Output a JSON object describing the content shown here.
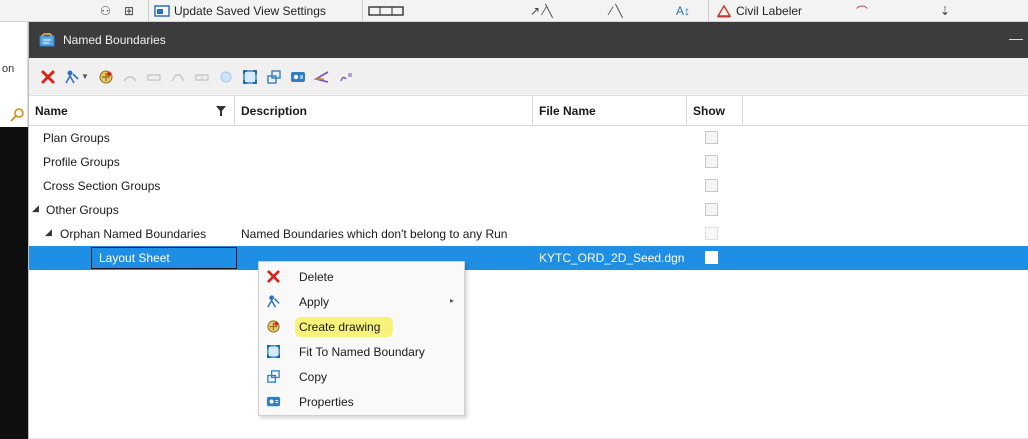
{
  "ribbon": {
    "update_saved_view_label": "Update Saved View Settings",
    "civil_labeler_label": "Civil Labeler",
    "left_fragment": "on"
  },
  "dialog": {
    "title": "Named Boundaries",
    "minimize_glyph": "—"
  },
  "toolbar": {
    "icons": [
      "delete-icon",
      "apply-icon",
      "create-drawing-icon",
      "plan-icon",
      "profile-icon",
      "cross-section-icon",
      "civil-icon",
      "named-boundary-icon",
      "fit-icon",
      "copy-icon",
      "properties-icon",
      "level-icon",
      "annotate-icon"
    ]
  },
  "grid": {
    "columns": [
      "Name",
      "Description",
      "File Name",
      "Show"
    ],
    "rows": [
      {
        "name": "Plan Groups",
        "description": "",
        "file": "",
        "level": 0,
        "expander": ""
      },
      {
        "name": "Profile Groups",
        "description": "",
        "file": "",
        "level": 0,
        "expander": ""
      },
      {
        "name": "Cross Section Groups",
        "description": "",
        "file": "",
        "level": 0,
        "expander": ""
      },
      {
        "name": "Other Groups",
        "description": "",
        "file": "",
        "level": 0,
        "expander": "◢"
      },
      {
        "name": "Orphan Named Boundaries",
        "description": "Named Boundaries which don't belong to any Run",
        "file": "",
        "level": 1,
        "expander": "◢"
      },
      {
        "name": "Layout Sheet",
        "description": "",
        "file": "KYTC_ORD_2D_Seed.dgn",
        "level": 2,
        "expander": "",
        "selected": true
      }
    ]
  },
  "context_menu": {
    "items": [
      {
        "label": "Delete",
        "icon": "delete-icon"
      },
      {
        "label": "Apply",
        "icon": "apply-icon",
        "submenu": "▸"
      },
      {
        "label": "Create drawing",
        "icon": "create-drawing-icon",
        "highlighted": true
      },
      {
        "label": "Fit To Named Boundary",
        "icon": "fit-icon"
      },
      {
        "label": "Copy",
        "icon": "copy-icon"
      },
      {
        "label": "Properties",
        "icon": "properties-icon"
      }
    ]
  },
  "colors": {
    "titlebar": "#3c3c3c",
    "selection": "#1f8fe5",
    "highlight": "#f6f26a",
    "delete_red": "#d9231c"
  }
}
